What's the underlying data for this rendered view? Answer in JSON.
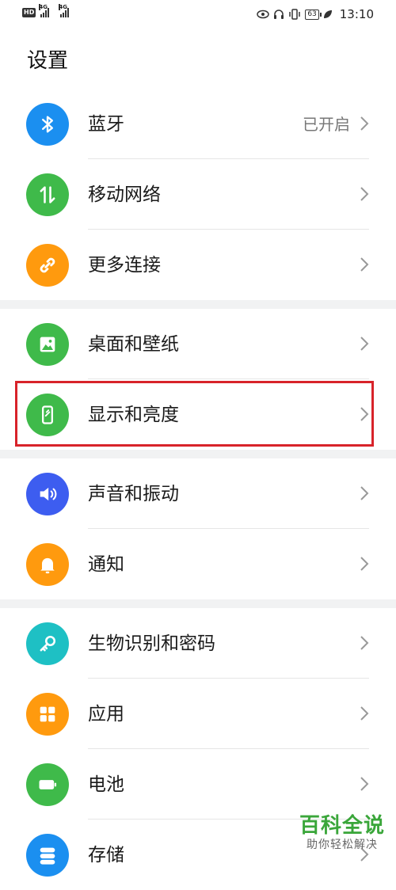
{
  "status_bar": {
    "hd": "HD",
    "signal_1": "4G",
    "signal_2": "4G",
    "battery": "63",
    "time": "13:10"
  },
  "page_title": "设置",
  "colors": {
    "blue": "#1b8ff0",
    "green": "#3fba4a",
    "orange": "#ff9a0e",
    "indigo": "#3d5df0",
    "teal": "#1ec0c4",
    "highlight": "#d8232a"
  },
  "groups": [
    {
      "items": [
        {
          "label": "蓝牙",
          "value": "已开启",
          "icon": "bluetooth-icon"
        },
        {
          "label": "移动网络",
          "value": "",
          "icon": "mobile-data-icon"
        },
        {
          "label": "更多连接",
          "value": "",
          "icon": "link-icon"
        }
      ]
    },
    {
      "items": [
        {
          "label": "桌面和壁纸",
          "value": "",
          "icon": "wallpaper-icon"
        },
        {
          "label": "显示和亮度",
          "value": "",
          "icon": "display-icon"
        }
      ]
    },
    {
      "items": [
        {
          "label": "声音和振动",
          "value": "",
          "icon": "sound-icon"
        },
        {
          "label": "通知",
          "value": "",
          "icon": "bell-icon"
        }
      ]
    },
    {
      "items": [
        {
          "label": "生物识别和密码",
          "value": "",
          "icon": "key-icon"
        },
        {
          "label": "应用",
          "value": "",
          "icon": "apps-icon"
        },
        {
          "label": "电池",
          "value": "",
          "icon": "battery-icon"
        },
        {
          "label": "存储",
          "value": "",
          "icon": "storage-icon"
        }
      ]
    }
  ],
  "watermark": {
    "main": "百科全说",
    "sub": "助你轻松解决"
  }
}
